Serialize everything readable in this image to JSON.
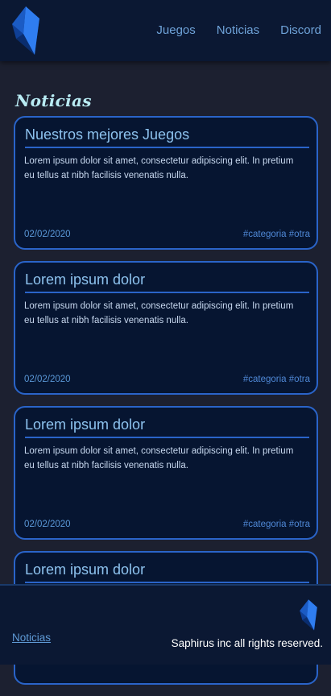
{
  "header": {
    "logo_icon": "crystal-logo-icon",
    "nav": [
      "Juegos",
      "Noticias",
      "Discord"
    ]
  },
  "main": {
    "section_title": "Noticias",
    "cards": [
      {
        "title": "Nuestros mejores Juegos",
        "body": "Lorem ipsum dolor sit amet, consectetur adipiscing elit. In pretium eu tellus at nibh facilisis venenatis nulla.",
        "date": "02/02/2020",
        "tags": "#categoria #otra"
      },
      {
        "title": "Lorem ipsum dolor",
        "body": "Lorem ipsum dolor sit amet, consectetur adipiscing elit. In pretium eu tellus at nibh facilisis venenatis nulla.",
        "date": "02/02/2020",
        "tags": "#categoria #otra"
      },
      {
        "title": "Lorem ipsum dolor",
        "body": "Lorem ipsum dolor sit amet, consectetur adipiscing elit. In pretium eu tellus at nibh facilisis venenatis nulla.",
        "date": "02/02/2020",
        "tags": "#categoria #otra"
      },
      {
        "title": "Lorem ipsum dolor",
        "body": "",
        "date": "",
        "tags": ""
      }
    ]
  },
  "footer": {
    "link": "Noticias",
    "copyright": "Saphirus inc all rights reserved.",
    "logo_icon": "crystal-logo-icon"
  },
  "colors": {
    "header_bg": "#0b1833",
    "page_bg": "#1c2030",
    "card_bg": "#061531",
    "accent": "#2a64c9",
    "title_text": "#8ec3ef"
  }
}
